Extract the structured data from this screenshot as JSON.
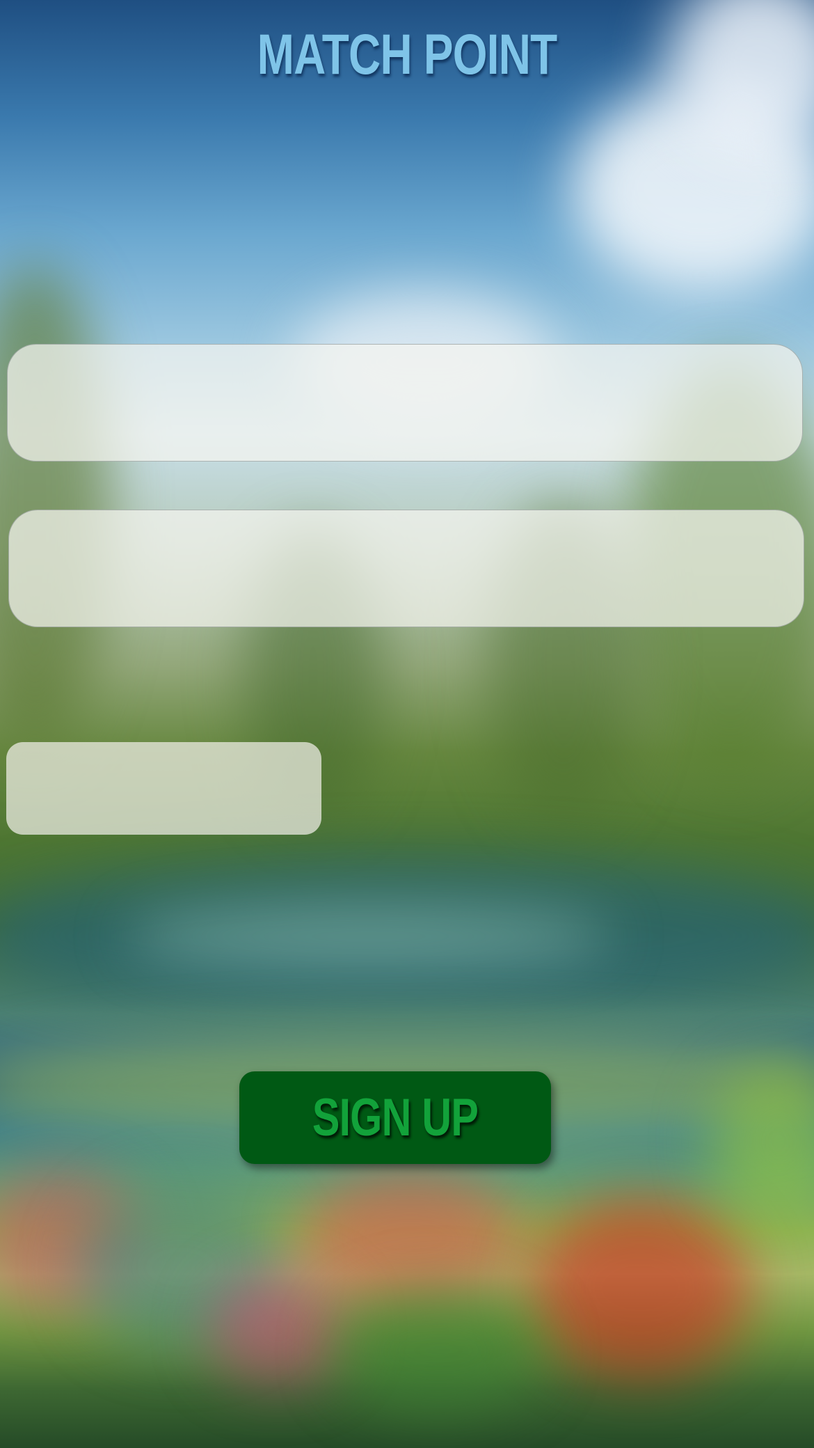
{
  "app": {
    "title": "MATCH POINT"
  },
  "form": {
    "field_1_value": "",
    "field_1_placeholder": "",
    "field_2_value": "",
    "field_2_placeholder": "",
    "field_3_value": "",
    "field_3_placeholder": ""
  },
  "actions": {
    "signup_label": "SIGN UP"
  },
  "colors": {
    "title_text": "#7fc4e8",
    "button_background": "#005914",
    "button_text": "#12a23a"
  }
}
